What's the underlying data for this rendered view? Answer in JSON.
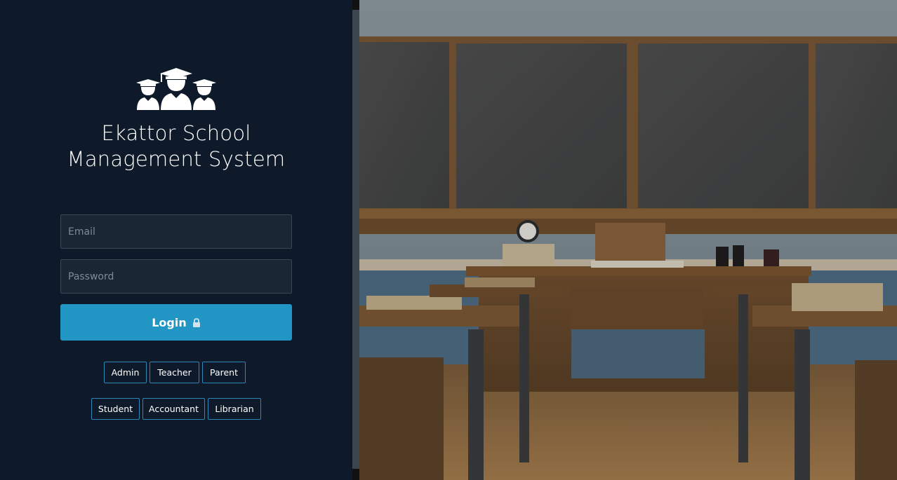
{
  "app": {
    "title_line1": "Ekattor School",
    "title_line2": "Management System"
  },
  "form": {
    "email_placeholder": "Email",
    "password_placeholder": "Password",
    "login_label": "Login"
  },
  "roles": {
    "row1": [
      "Admin",
      "Teacher",
      "Parent"
    ],
    "row2": [
      "Student",
      "Accountant",
      "Librarian"
    ]
  },
  "colors": {
    "panel_bg": "#0e1a29",
    "accent": "#2196c4",
    "role_border": "#2e86b8"
  },
  "icons": {
    "logo": "students-graduation-icon",
    "lock": "lock-icon"
  }
}
